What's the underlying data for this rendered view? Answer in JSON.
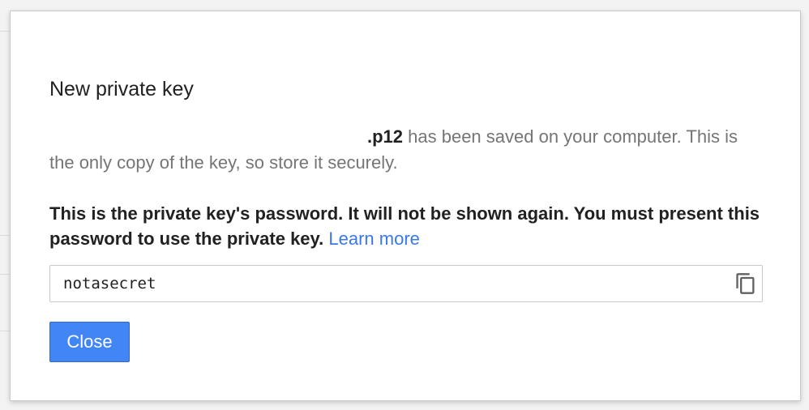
{
  "dialog": {
    "title": "New private key",
    "saved_message": {
      "extension": ".p12",
      "text": " has been saved on your computer. This is the only copy of the key, so store it securely."
    },
    "password_note": {
      "text": "This is the private key's password. It will not be shown again. You must present this password to use the private key. ",
      "link_label": "Learn more"
    },
    "password_field": {
      "value": "notasecret",
      "copy_icon": "copy-icon"
    },
    "close_label": "Close"
  },
  "colors": {
    "primary_button": "#4285f4",
    "link": "#3b78e7",
    "body_text": "#757575",
    "strong_text": "#212121"
  }
}
